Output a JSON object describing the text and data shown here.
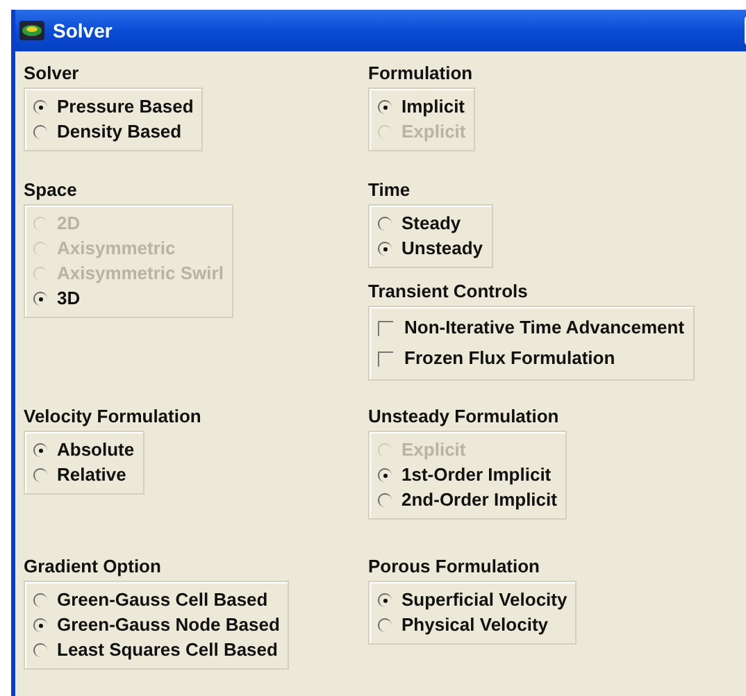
{
  "window": {
    "title": "Solver"
  },
  "rows": [
    [
      {
        "title": "Solver",
        "kind": "radio",
        "options": [
          {
            "label": "Pressure Based",
            "selected": true,
            "disabled": false
          },
          {
            "label": "Density Based",
            "selected": false,
            "disabled": false
          }
        ]
      }
    ],
    [
      {
        "title": "Formulation",
        "kind": "radio",
        "options": [
          {
            "label": "Implicit",
            "selected": true,
            "disabled": false
          },
          {
            "label": "Explicit",
            "selected": false,
            "disabled": true
          }
        ]
      }
    ],
    [
      {
        "title": "Space",
        "kind": "radio",
        "options": [
          {
            "label": "2D",
            "selected": false,
            "disabled": true
          },
          {
            "label": "Axisymmetric",
            "selected": false,
            "disabled": true
          },
          {
            "label": "Axisymmetric Swirl",
            "selected": false,
            "disabled": true
          },
          {
            "label": "3D",
            "selected": true,
            "disabled": false
          }
        ]
      }
    ],
    [
      {
        "title": "Time",
        "kind": "radio",
        "options": [
          {
            "label": "Steady",
            "selected": false,
            "disabled": false
          },
          {
            "label": "Unsteady",
            "selected": true,
            "disabled": false
          }
        ]
      },
      {
        "title": "Transient Controls",
        "kind": "checkbox",
        "options": [
          {
            "label": "Non-Iterative Time Advancement",
            "checked": false
          },
          {
            "label": "Frozen Flux Formulation",
            "checked": false
          }
        ]
      }
    ],
    [
      {
        "title": "Velocity Formulation",
        "kind": "radio",
        "options": [
          {
            "label": "Absolute",
            "selected": true,
            "disabled": false
          },
          {
            "label": "Relative",
            "selected": false,
            "disabled": false
          }
        ]
      }
    ],
    [
      {
        "title": "Unsteady Formulation",
        "kind": "radio",
        "options": [
          {
            "label": "Explicit",
            "selected": false,
            "disabled": true
          },
          {
            "label": "1st-Order Implicit",
            "selected": true,
            "disabled": false
          },
          {
            "label": "2nd-Order Implicit",
            "selected": false,
            "disabled": false
          }
        ]
      }
    ],
    [
      {
        "title": "Gradient Option",
        "kind": "radio",
        "options": [
          {
            "label": "Green-Gauss Cell Based",
            "selected": false,
            "disabled": false
          },
          {
            "label": "Green-Gauss Node Based",
            "selected": true,
            "disabled": false
          },
          {
            "label": "Least Squares Cell Based",
            "selected": false,
            "disabled": false
          }
        ]
      }
    ],
    [
      {
        "title": "Porous Formulation",
        "kind": "radio",
        "options": [
          {
            "label": "Superficial Velocity",
            "selected": true,
            "disabled": false
          },
          {
            "label": "Physical Velocity",
            "selected": false,
            "disabled": false
          }
        ]
      }
    ]
  ]
}
